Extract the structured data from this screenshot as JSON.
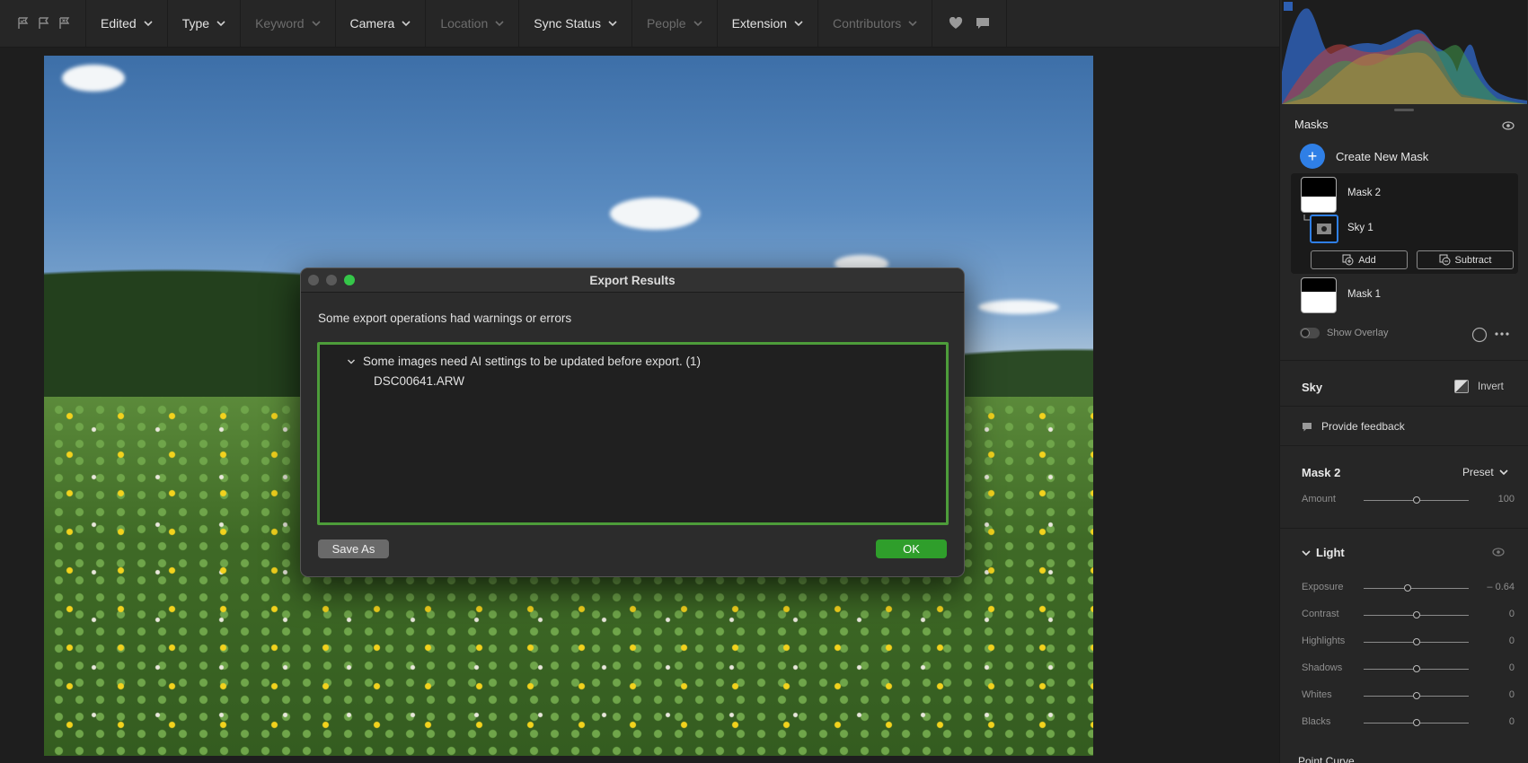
{
  "filterbar": {
    "filters": [
      {
        "label": "Edited",
        "dim": false
      },
      {
        "label": "Type",
        "dim": false
      },
      {
        "label": "Keyword",
        "dim": true
      },
      {
        "label": "Camera",
        "dim": false
      },
      {
        "label": "Location",
        "dim": true
      },
      {
        "label": "Sync Status",
        "dim": false
      },
      {
        "label": "People",
        "dim": true
      },
      {
        "label": "Extension",
        "dim": false
      },
      {
        "label": "Contributors",
        "dim": true
      }
    ],
    "icons": [
      "flag-pick-icon",
      "flag-unflagged-icon",
      "flag-reject-icon",
      "heart-icon",
      "comment-icon"
    ]
  },
  "dialog": {
    "title": "Export Results",
    "message": "Some export operations had warnings or errors",
    "group_label": "Some images need AI settings to be updated before export. (1)",
    "file": "DSC00641.ARW",
    "save_as": "Save As",
    "ok": "OK"
  },
  "panel": {
    "masks_title": "Masks",
    "create_mask": "Create New Mask",
    "mask2": "Mask 2",
    "sky1": "Sky 1",
    "add": "Add",
    "subtract": "Subtract",
    "mask1": "Mask 1",
    "show_overlay": "Show Overlay",
    "sky_section": "Sky",
    "invert": "Invert",
    "provide_feedback": "Provide feedback",
    "mask2_section": "Mask 2",
    "preset": "Preset",
    "amount": {
      "label": "Amount",
      "value": "100",
      "level": 0.5
    },
    "light_title": "Light",
    "light_sliders": [
      {
        "label": "Exposure",
        "value": "– 0.64",
        "level": 0.42
      },
      {
        "label": "Contrast",
        "value": "0",
        "level": 0.5
      },
      {
        "label": "Highlights",
        "value": "0",
        "level": 0.5
      },
      {
        "label": "Shadows",
        "value": "0",
        "level": 0.5
      },
      {
        "label": "Whites",
        "value": "0",
        "level": 0.5
      },
      {
        "label": "Blacks",
        "value": "0",
        "level": 0.5
      }
    ],
    "point_curve": "Point Curve"
  },
  "colors": {
    "accent_blue": "#2f7fe6",
    "ok_green": "#2f9e2b",
    "highlight_green": "#4d9c3a"
  }
}
